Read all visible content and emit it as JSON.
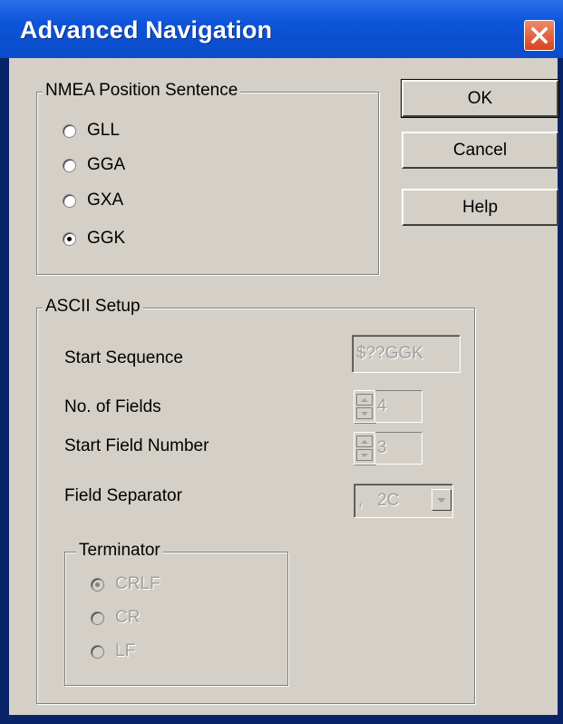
{
  "window": {
    "title": "Advanced Navigation"
  },
  "nmea_group": {
    "legend": "NMEA Position Sentence",
    "options": [
      {
        "label": "GLL",
        "checked": false
      },
      {
        "label": "GGA",
        "checked": false
      },
      {
        "label": "GXA",
        "checked": false
      },
      {
        "label": "GGK",
        "checked": true
      }
    ]
  },
  "buttons": {
    "ok": "OK",
    "cancel": "Cancel",
    "help": "Help"
  },
  "ascii_group": {
    "legend": "ASCII Setup",
    "start_sequence": {
      "label": "Start Sequence",
      "value": "$??GGK"
    },
    "no_of_fields": {
      "label": "No. of Fields",
      "value": "4"
    },
    "start_field_number": {
      "label": "Start Field Number",
      "value": "3"
    },
    "field_separator": {
      "label": "Field Separator",
      "value": ",   2C"
    }
  },
  "terminator_group": {
    "legend": "Terminator",
    "options": [
      {
        "label": "CRLF",
        "checked": true
      },
      {
        "label": "CR",
        "checked": false
      },
      {
        "label": "LF",
        "checked": false
      }
    ]
  },
  "colors": {
    "title_bar": "#0d54d9",
    "dialog_face": "#d4d0c8",
    "close_button": "#d9421c",
    "disabled_text": "#a0a0a0"
  }
}
